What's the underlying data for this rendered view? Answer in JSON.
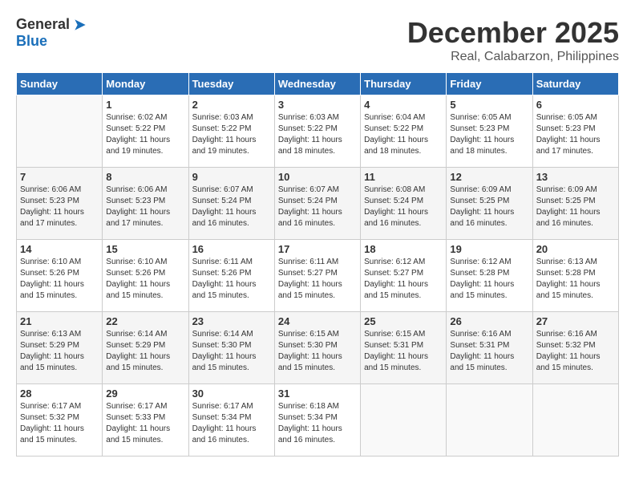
{
  "logo": {
    "general": "General",
    "blue": "Blue"
  },
  "title": {
    "month": "December 2025",
    "location": "Real, Calabarzon, Philippines"
  },
  "days_of_week": [
    "Sunday",
    "Monday",
    "Tuesday",
    "Wednesday",
    "Thursday",
    "Friday",
    "Saturday"
  ],
  "weeks": [
    {
      "shade": false,
      "days": [
        {
          "num": "",
          "sunrise": "",
          "sunset": "",
          "daylight": ""
        },
        {
          "num": "1",
          "sunrise": "Sunrise: 6:02 AM",
          "sunset": "Sunset: 5:22 PM",
          "daylight": "Daylight: 11 hours and 19 minutes."
        },
        {
          "num": "2",
          "sunrise": "Sunrise: 6:03 AM",
          "sunset": "Sunset: 5:22 PM",
          "daylight": "Daylight: 11 hours and 19 minutes."
        },
        {
          "num": "3",
          "sunrise": "Sunrise: 6:03 AM",
          "sunset": "Sunset: 5:22 PM",
          "daylight": "Daylight: 11 hours and 18 minutes."
        },
        {
          "num": "4",
          "sunrise": "Sunrise: 6:04 AM",
          "sunset": "Sunset: 5:22 PM",
          "daylight": "Daylight: 11 hours and 18 minutes."
        },
        {
          "num": "5",
          "sunrise": "Sunrise: 6:05 AM",
          "sunset": "Sunset: 5:23 PM",
          "daylight": "Daylight: 11 hours and 18 minutes."
        },
        {
          "num": "6",
          "sunrise": "Sunrise: 6:05 AM",
          "sunset": "Sunset: 5:23 PM",
          "daylight": "Daylight: 11 hours and 17 minutes."
        }
      ]
    },
    {
      "shade": true,
      "days": [
        {
          "num": "7",
          "sunrise": "Sunrise: 6:06 AM",
          "sunset": "Sunset: 5:23 PM",
          "daylight": "Daylight: 11 hours and 17 minutes."
        },
        {
          "num": "8",
          "sunrise": "Sunrise: 6:06 AM",
          "sunset": "Sunset: 5:23 PM",
          "daylight": "Daylight: 11 hours and 17 minutes."
        },
        {
          "num": "9",
          "sunrise": "Sunrise: 6:07 AM",
          "sunset": "Sunset: 5:24 PM",
          "daylight": "Daylight: 11 hours and 16 minutes."
        },
        {
          "num": "10",
          "sunrise": "Sunrise: 6:07 AM",
          "sunset": "Sunset: 5:24 PM",
          "daylight": "Daylight: 11 hours and 16 minutes."
        },
        {
          "num": "11",
          "sunrise": "Sunrise: 6:08 AM",
          "sunset": "Sunset: 5:24 PM",
          "daylight": "Daylight: 11 hours and 16 minutes."
        },
        {
          "num": "12",
          "sunrise": "Sunrise: 6:09 AM",
          "sunset": "Sunset: 5:25 PM",
          "daylight": "Daylight: 11 hours and 16 minutes."
        },
        {
          "num": "13",
          "sunrise": "Sunrise: 6:09 AM",
          "sunset": "Sunset: 5:25 PM",
          "daylight": "Daylight: 11 hours and 16 minutes."
        }
      ]
    },
    {
      "shade": false,
      "days": [
        {
          "num": "14",
          "sunrise": "Sunrise: 6:10 AM",
          "sunset": "Sunset: 5:26 PM",
          "daylight": "Daylight: 11 hours and 15 minutes."
        },
        {
          "num": "15",
          "sunrise": "Sunrise: 6:10 AM",
          "sunset": "Sunset: 5:26 PM",
          "daylight": "Daylight: 11 hours and 15 minutes."
        },
        {
          "num": "16",
          "sunrise": "Sunrise: 6:11 AM",
          "sunset": "Sunset: 5:26 PM",
          "daylight": "Daylight: 11 hours and 15 minutes."
        },
        {
          "num": "17",
          "sunrise": "Sunrise: 6:11 AM",
          "sunset": "Sunset: 5:27 PM",
          "daylight": "Daylight: 11 hours and 15 minutes."
        },
        {
          "num": "18",
          "sunrise": "Sunrise: 6:12 AM",
          "sunset": "Sunset: 5:27 PM",
          "daylight": "Daylight: 11 hours and 15 minutes."
        },
        {
          "num": "19",
          "sunrise": "Sunrise: 6:12 AM",
          "sunset": "Sunset: 5:28 PM",
          "daylight": "Daylight: 11 hours and 15 minutes."
        },
        {
          "num": "20",
          "sunrise": "Sunrise: 6:13 AM",
          "sunset": "Sunset: 5:28 PM",
          "daylight": "Daylight: 11 hours and 15 minutes."
        }
      ]
    },
    {
      "shade": true,
      "days": [
        {
          "num": "21",
          "sunrise": "Sunrise: 6:13 AM",
          "sunset": "Sunset: 5:29 PM",
          "daylight": "Daylight: 11 hours and 15 minutes."
        },
        {
          "num": "22",
          "sunrise": "Sunrise: 6:14 AM",
          "sunset": "Sunset: 5:29 PM",
          "daylight": "Daylight: 11 hours and 15 minutes."
        },
        {
          "num": "23",
          "sunrise": "Sunrise: 6:14 AM",
          "sunset": "Sunset: 5:30 PM",
          "daylight": "Daylight: 11 hours and 15 minutes."
        },
        {
          "num": "24",
          "sunrise": "Sunrise: 6:15 AM",
          "sunset": "Sunset: 5:30 PM",
          "daylight": "Daylight: 11 hours and 15 minutes."
        },
        {
          "num": "25",
          "sunrise": "Sunrise: 6:15 AM",
          "sunset": "Sunset: 5:31 PM",
          "daylight": "Daylight: 11 hours and 15 minutes."
        },
        {
          "num": "26",
          "sunrise": "Sunrise: 6:16 AM",
          "sunset": "Sunset: 5:31 PM",
          "daylight": "Daylight: 11 hours and 15 minutes."
        },
        {
          "num": "27",
          "sunrise": "Sunrise: 6:16 AM",
          "sunset": "Sunset: 5:32 PM",
          "daylight": "Daylight: 11 hours and 15 minutes."
        }
      ]
    },
    {
      "shade": false,
      "days": [
        {
          "num": "28",
          "sunrise": "Sunrise: 6:17 AM",
          "sunset": "Sunset: 5:32 PM",
          "daylight": "Daylight: 11 hours and 15 minutes."
        },
        {
          "num": "29",
          "sunrise": "Sunrise: 6:17 AM",
          "sunset": "Sunset: 5:33 PM",
          "daylight": "Daylight: 11 hours and 15 minutes."
        },
        {
          "num": "30",
          "sunrise": "Sunrise: 6:17 AM",
          "sunset": "Sunset: 5:34 PM",
          "daylight": "Daylight: 11 hours and 16 minutes."
        },
        {
          "num": "31",
          "sunrise": "Sunrise: 6:18 AM",
          "sunset": "Sunset: 5:34 PM",
          "daylight": "Daylight: 11 hours and 16 minutes."
        },
        {
          "num": "",
          "sunrise": "",
          "sunset": "",
          "daylight": ""
        },
        {
          "num": "",
          "sunrise": "",
          "sunset": "",
          "daylight": ""
        },
        {
          "num": "",
          "sunrise": "",
          "sunset": "",
          "daylight": ""
        }
      ]
    }
  ]
}
